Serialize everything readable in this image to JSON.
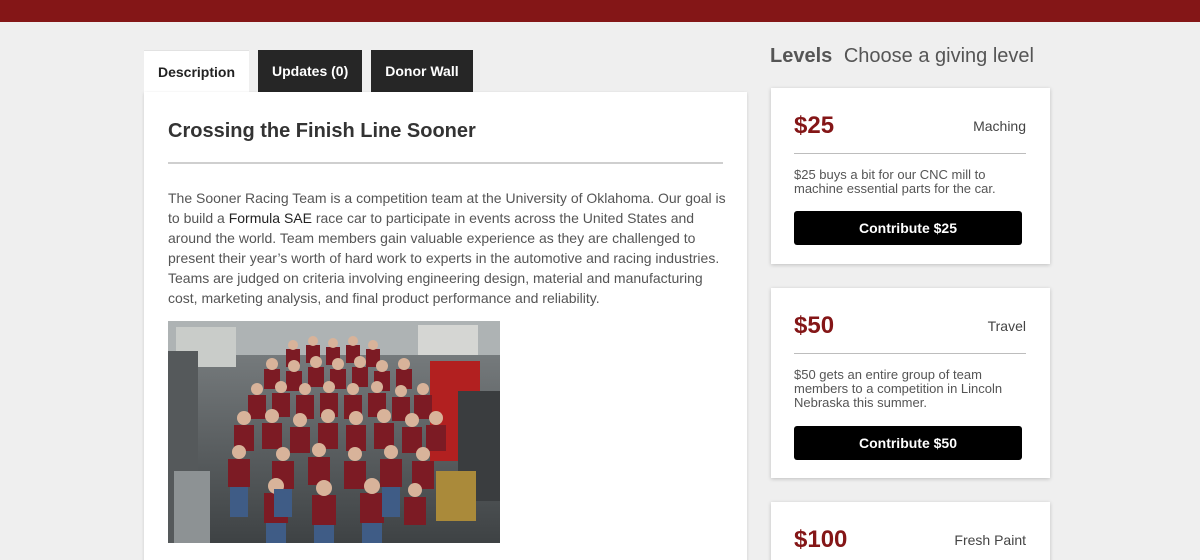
{
  "tabs": [
    {
      "label": "Description"
    },
    {
      "label": "Updates (0)"
    },
    {
      "label": "Donor Wall"
    }
  ],
  "main": {
    "title": "Crossing the Finish Line Sooner",
    "desc_before": "The Sooner Racing Team is a competition team at the University of Oklahoma. Our goal is to build a ",
    "desc_link": "Formula SAE",
    "desc_after": " race car to participate in events across the United States and around the world. Team members gain valuable experience as they are challenged to present their year’s worth of hard work to experts in the automotive and racing industries. Teams are judged on criteria involving engineering design, material and manufacturing cost, marketing analysis, and final product performance and reliability."
  },
  "levels": {
    "heading": "Levels",
    "subheading": "Choose a giving level",
    "items": [
      {
        "amount": "$25",
        "name": "Maching",
        "description": "$25 buys a bit for our CNC mill to machine essential parts for the car.",
        "button": "Contribute $25"
      },
      {
        "amount": "$50",
        "name": "Travel",
        "description": "$50 gets an entire group of team members to a competition in Lincoln Nebraska this summer.",
        "button": "Contribute $50"
      },
      {
        "amount": "$100",
        "name": "Fresh Paint",
        "description": "",
        "button": ""
      }
    ]
  },
  "colors": {
    "brand": "#841617",
    "button": "#000000",
    "tab_dark": "#262626"
  }
}
